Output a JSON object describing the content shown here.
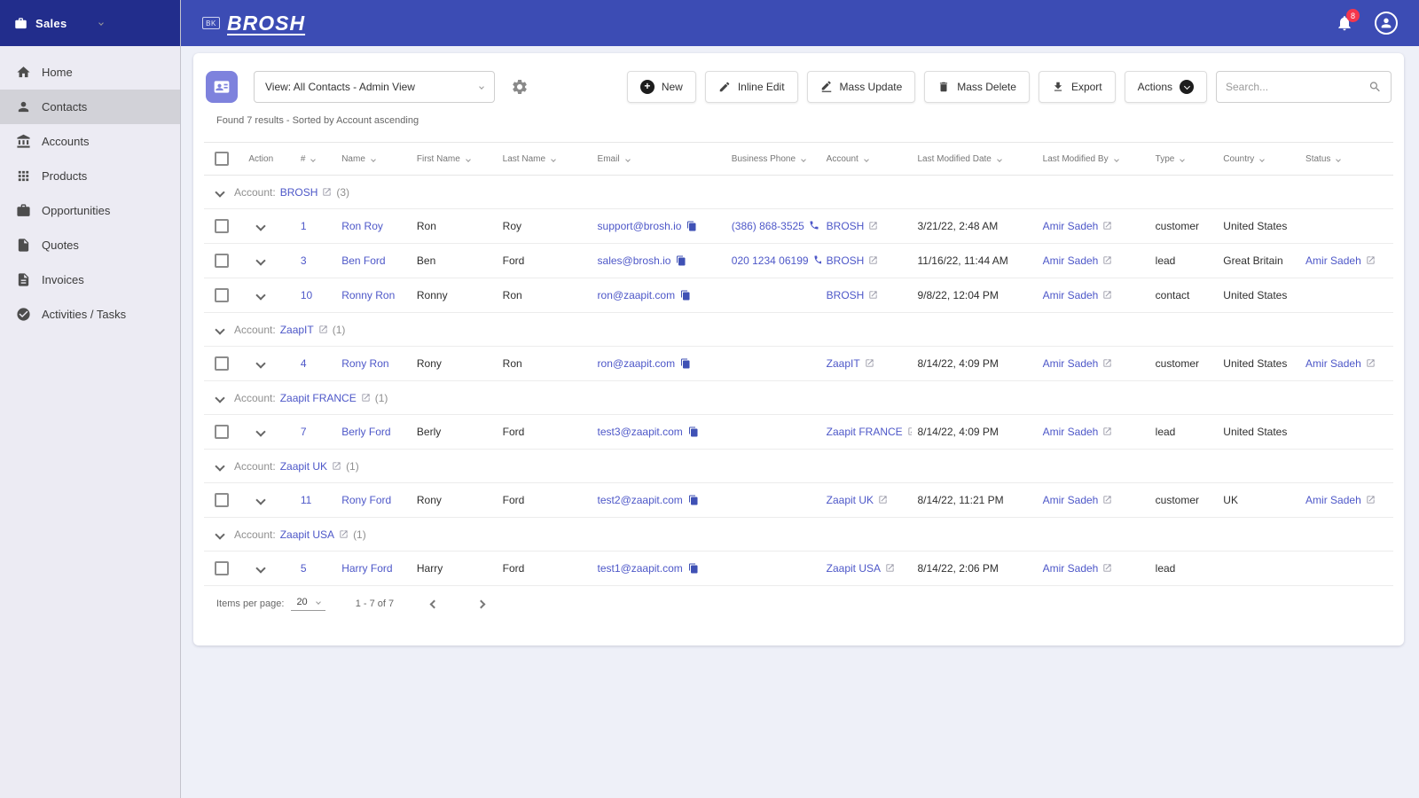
{
  "topbar": {
    "brand": "BROSH",
    "logo_badge": "BK",
    "notification_count": "8"
  },
  "app_switcher": {
    "app_name": "Sales"
  },
  "sidebar": {
    "items": [
      {
        "label": "Home"
      },
      {
        "label": "Contacts"
      },
      {
        "label": "Accounts"
      },
      {
        "label": "Products"
      },
      {
        "label": "Opportunities"
      },
      {
        "label": "Quotes"
      },
      {
        "label": "Invoices"
      },
      {
        "label": "Activities / Tasks"
      }
    ]
  },
  "toolbar": {
    "view_selector": "View: All Contacts - Admin View",
    "buttons": {
      "new": "New",
      "inline_edit": "Inline Edit",
      "mass_update": "Mass Update",
      "mass_delete": "Mass Delete",
      "export": "Export",
      "actions": "Actions"
    },
    "search_placeholder": "Search..."
  },
  "results_text": "Found 7 results - Sorted by Account ascending",
  "table": {
    "group_label": "Account:",
    "columns": [
      {
        "label": "Action",
        "sortable": false
      },
      {
        "label": "#",
        "sortable": true
      },
      {
        "label": "Name",
        "sortable": true
      },
      {
        "label": "First Name",
        "sortable": true
      },
      {
        "label": "Last Name",
        "sortable": true
      },
      {
        "label": "Email",
        "sortable": true
      },
      {
        "label": "Business Phone",
        "sortable": true
      },
      {
        "label": "Account",
        "sortable": true
      },
      {
        "label": "Last Modified Date",
        "sortable": true
      },
      {
        "label": "Last Modified By",
        "sortable": true
      },
      {
        "label": "Type",
        "sortable": true
      },
      {
        "label": "Country",
        "sortable": true
      },
      {
        "label": "Status",
        "sortable": true
      }
    ],
    "groups": [
      {
        "account": "BROSH",
        "count": "3",
        "rows": [
          {
            "num": "1",
            "name": "Ron Roy",
            "first": "Ron",
            "last": "Roy",
            "email": "support@brosh.io",
            "phone": "(386) 868-3525",
            "account": "BROSH",
            "modified_date": "3/21/22, 2:48 AM",
            "modified_by": "Amir Sadeh",
            "type": "customer",
            "country": "United States",
            "status": ""
          },
          {
            "num": "3",
            "name": "Ben Ford",
            "first": "Ben",
            "last": "Ford",
            "email": "sales@brosh.io",
            "phone": "020 1234 06199",
            "account": "BROSH",
            "modified_date": "11/16/22, 11:44 AM",
            "modified_by": "Amir Sadeh",
            "type": "lead",
            "country": "Great Britain",
            "status": "Amir Sadeh"
          },
          {
            "num": "10",
            "name": "Ronny Ron",
            "first": "Ronny",
            "last": "Ron",
            "email": "ron@zaapit.com",
            "phone": "",
            "account": "BROSH",
            "modified_date": "9/8/22, 12:04 PM",
            "modified_by": "Amir Sadeh",
            "type": "contact",
            "country": "United States",
            "status": ""
          }
        ]
      },
      {
        "account": "ZaapIT",
        "count": "1",
        "rows": [
          {
            "num": "4",
            "name": "Rony Ron",
            "first": "Rony",
            "last": "Ron",
            "email": "ron@zaapit.com",
            "phone": "",
            "account": "ZaapIT",
            "modified_date": "8/14/22, 4:09 PM",
            "modified_by": "Amir Sadeh",
            "type": "customer",
            "country": "United States",
            "status": "Amir Sadeh"
          }
        ]
      },
      {
        "account": "Zaapit FRANCE",
        "count": "1",
        "rows": [
          {
            "num": "7",
            "name": "Berly Ford",
            "first": "Berly",
            "last": "Ford",
            "email": "test3@zaapit.com",
            "phone": "",
            "account": "Zaapit FRANCE",
            "modified_date": "8/14/22, 4:09 PM",
            "modified_by": "Amir Sadeh",
            "type": "lead",
            "country": "United States",
            "status": ""
          }
        ]
      },
      {
        "account": "Zaapit UK",
        "count": "1",
        "rows": [
          {
            "num": "11",
            "name": "Rony Ford",
            "first": "Rony",
            "last": "Ford",
            "email": "test2@zaapit.com",
            "phone": "",
            "account": "Zaapit UK",
            "modified_date": "8/14/22, 11:21 PM",
            "modified_by": "Amir Sadeh",
            "type": "customer",
            "country": "UK",
            "status": "Amir Sadeh"
          }
        ]
      },
      {
        "account": "Zaapit USA",
        "count": "1",
        "rows": [
          {
            "num": "5",
            "name": "Harry Ford",
            "first": "Harry",
            "last": "Ford",
            "email": "test1@zaapit.com",
            "phone": "",
            "account": "Zaapit USA",
            "modified_date": "8/14/22, 2:06 PM",
            "modified_by": "Amir Sadeh",
            "type": "lead",
            "country": "",
            "status": ""
          }
        ]
      }
    ]
  },
  "pagination": {
    "items_per_page_label": "Items per page:",
    "items_per_page": "20",
    "range": "1 - 7 of 7"
  }
}
